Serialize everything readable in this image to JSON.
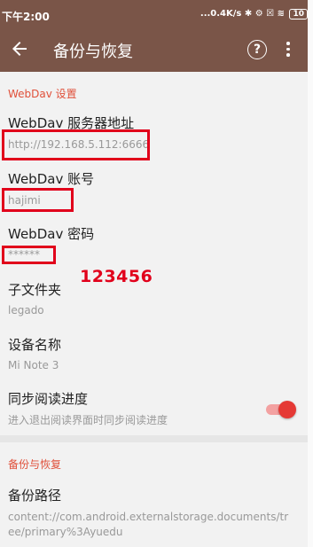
{
  "status_bar": {
    "time": "下午2:00",
    "right": "...0.4K/s ✱ ⚙ ☒ ≋",
    "battery": "10"
  },
  "toolbar": {
    "title": "备份与恢复",
    "help_label": "?"
  },
  "webdav": {
    "section_title": "WebDav 设置",
    "server_title": "WebDav 服务器地址",
    "server_value": "http://192.168.5.112:6666",
    "account_title": "WebDav 账号",
    "account_value": "hajimi",
    "password_title": "WebDav 密码",
    "password_value": "******",
    "annotation": "123456",
    "subdir_title": "子文件夹",
    "subdir_value": "legado",
    "device_title": "设备名称",
    "device_value": "Mi Note 3",
    "sync_title": "同步阅读进度",
    "sync_summary": "进入退出阅读界面时同步阅读进度",
    "sync_enabled": true
  },
  "backup": {
    "section_title": "备份与恢复",
    "path_title": "备份路径",
    "path_value": "content://com.android.externalstorage.documents/tree/primary%3Ayuedu"
  },
  "colors": {
    "toolbar": "#7a5548",
    "accent": "#e0503a",
    "highlight": "#e1001b",
    "toggle_on": "#e53935"
  }
}
